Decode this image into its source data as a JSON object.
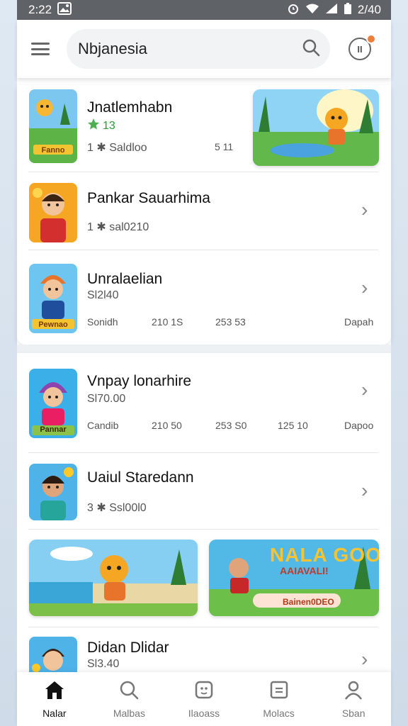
{
  "status": {
    "time": "2:22",
    "right_text": "2/40"
  },
  "appbar": {
    "menu_icon": "hamburger-icon",
    "search_value": "Nbjanesia",
    "search_icon": "search-icon",
    "notif_icon": "pause-bell-icon",
    "notif_glyph": "II"
  },
  "list": [
    {
      "title": "Jnatlemhabn",
      "rating": "13",
      "sub": "1 ✱ Saldloo",
      "meta": [
        "5 11"
      ]
    },
    {
      "title": "Pankar Sauarhima",
      "sub": "1 ✱ sal0210"
    },
    {
      "title": "Unralaelian",
      "price": "Sl2l40",
      "meta": [
        "Sonidh",
        "210 1S",
        "253 53",
        "Dapah"
      ]
    },
    {
      "title": "Vnpay lonarhire",
      "price": "Sl70.00",
      "meta": [
        "Candib",
        "210 50",
        "253 S0",
        "125 10",
        "Dapoo"
      ]
    },
    {
      "title": "Uaiul Staredann",
      "sub": "3 ✱ Ssl00l0"
    },
    {
      "title": "Didan Dlidar",
      "price": "Sl3.40"
    }
  ],
  "banners": {
    "thumb_label_1": "Fanno",
    "thumb_label_3": "Pewnao",
    "thumb_label_4": "Pannar",
    "promo_title": "NALA GOO!",
    "promo_sub": "AAIAVALI!",
    "promo_button": "Bainen0DEO"
  },
  "nav": [
    {
      "label": "Nalar",
      "icon": "home-icon",
      "active": true
    },
    {
      "label": "Malbas",
      "icon": "search-icon",
      "active": false
    },
    {
      "label": "Ilaoass",
      "icon": "game-icon",
      "active": false
    },
    {
      "label": "Molacs",
      "icon": "list-icon",
      "active": false
    },
    {
      "label": "Sban",
      "icon": "profile-icon",
      "active": false
    }
  ],
  "colors": {
    "accent": "#ef7d3c",
    "rating_green": "#2e9b3a",
    "statusbar": "#5f6368"
  }
}
